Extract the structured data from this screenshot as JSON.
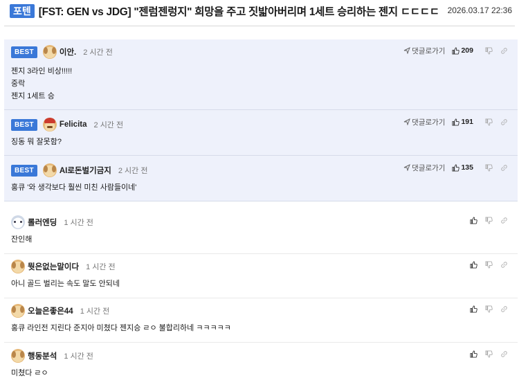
{
  "post": {
    "tag": "포텐",
    "title": "[FST: GEN vs JDG] \"젠럼젠렁지\" 희망을 주고 짓밟아버리며 1세트 승리하는 젠지 ㄷㄷㄷㄷ",
    "date": "2026.03.17 22:36"
  },
  "labels": {
    "best": "BEST",
    "reply": "댓글로가기"
  },
  "best_comments": [
    {
      "nick": "이안.",
      "avatar": "dog-icon",
      "time": "2 시간 전",
      "likes": "209",
      "lines": [
        "젠지 3라인 비상!!!!!",
        "중락",
        "젠지 1세트 승"
      ]
    },
    {
      "nick": "Felicita",
      "avatar": "santa-dog-icon",
      "time": "2 시간 전",
      "likes": "191",
      "lines": [
        "징동 뭐 잘못함?"
      ]
    },
    {
      "nick": "AI로돈벌기금지",
      "avatar": "dog-icon",
      "time": "2 시간 전",
      "likes": "135",
      "lines": [
        "홍큐 '와 생각보다 훨씬 미친 사람들이네'"
      ]
    }
  ],
  "comments": [
    {
      "nick": "롤러엔딩",
      "avatar": "white-mascot-icon",
      "time": "1 시간 전",
      "lines": [
        "잔인해"
      ]
    },
    {
      "nick": "뭣은없는말이다",
      "avatar": "dog-icon",
      "time": "1 시간 전",
      "lines": [
        "아니 골드 벌리는 속도 말도 안되네"
      ]
    },
    {
      "nick": "오늘은좋은44",
      "avatar": "dog-icon",
      "time": "1 시간 전",
      "lines": [
        "홍큐 라인전 지린다 준지아 미쳤다 젠지승 ㄹㅇ 불합리하네 ㅋㅋㅋㅋㅋ"
      ]
    },
    {
      "nick": "행동분석",
      "avatar": "dog-icon",
      "time": "1 시간 전",
      "lines": [
        "미쳤다 ㄹㅇ"
      ]
    }
  ],
  "colors": {
    "accent": "#3a78d8",
    "best_bg": "#eef1fb"
  }
}
